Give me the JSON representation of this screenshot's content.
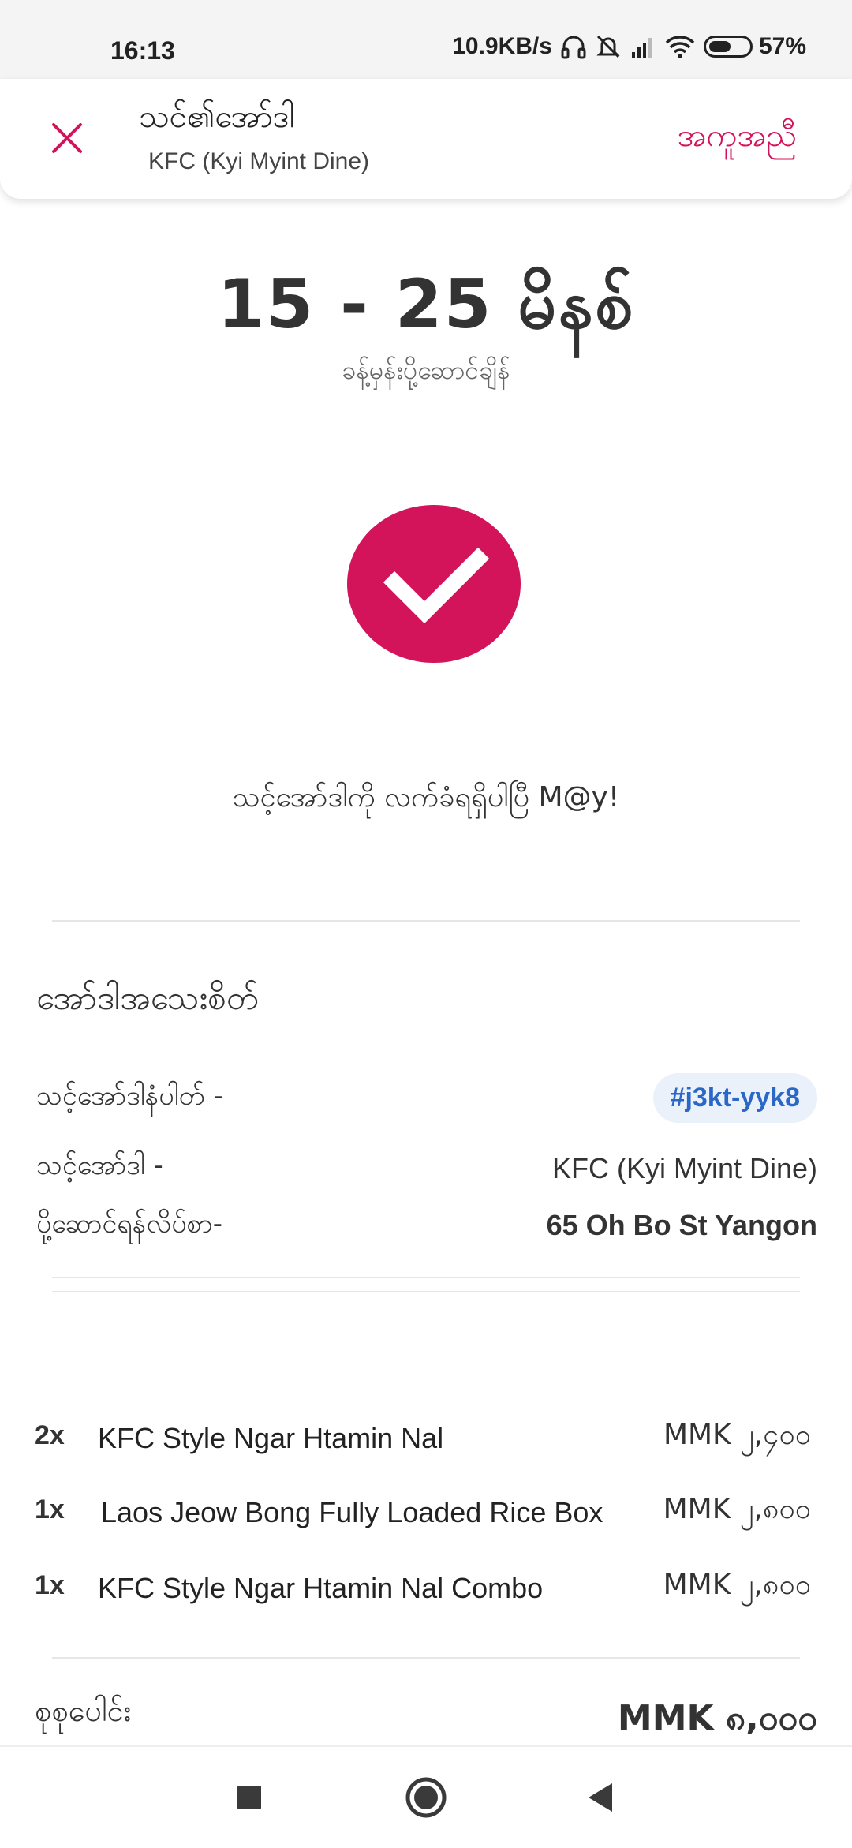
{
  "status_bar": {
    "time": "16:13",
    "net_speed": "10.9KB/s",
    "battery": "57%",
    "battery_level": 0.57,
    "icons": [
      "headphones-icon",
      "mute-icon",
      "signal-icon",
      "wifi-icon",
      "battery-icon"
    ]
  },
  "header": {
    "title": "သင်၏အော်ဒါ",
    "subtitle": "KFC (Kyi Myint Dine)",
    "help_label": "အကူအညီ",
    "accent_color": "#d3145a"
  },
  "eta": {
    "value": "15 - 25 မိနစ်",
    "label": "ခန့်မှန်းပို့ဆောင်ချိန်"
  },
  "confirmation": {
    "message": "သင့်အော်ဒါကို လက်ခံရရှိပါပြီ M@y!"
  },
  "details": {
    "section_title": "အော်ဒါအသေးစိတ်",
    "order_number_label": "သင့်အော်ဒါနံပါတ် -",
    "order_number": "#j3kt-yyk8",
    "restaurant_label": "သင့်အော်ဒါ -",
    "restaurant": "KFC (Kyi Myint Dine)",
    "address_label": "ပို့ဆောင်ရန်လိပ်စာ-",
    "address": "65 Oh Bo St Yangon"
  },
  "items": [
    {
      "qty": "2x",
      "name": "KFC Style Ngar Htamin Nal",
      "price": "MMK ၂,၄၀၀"
    },
    {
      "qty": "1x",
      "name": "Laos Jeow Bong Fully Loaded Rice Box",
      "price": "MMK ၂,၈၀၀"
    },
    {
      "qty": "1x",
      "name": "KFC Style Ngar Htamin Nal Combo",
      "price": "MMK ၂,၈၀၀"
    }
  ],
  "total": {
    "label": "စုစုပေါင်း",
    "value": "MMK ၈,၀၀၀"
  },
  "nav": {
    "icons": [
      "recent-apps-icon",
      "home-icon",
      "back-icon"
    ]
  }
}
